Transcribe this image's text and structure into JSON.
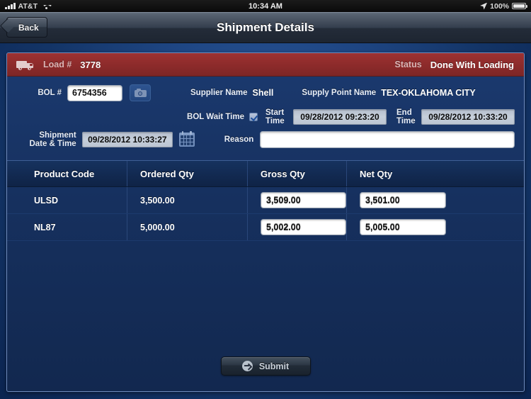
{
  "status_bar": {
    "carrier": "AT&T",
    "signal_icon": "signal-bars-icon",
    "wifi_icon": "wifi-icon",
    "time": "10:34 AM",
    "location_icon": "location-arrow-icon",
    "battery_percent": "100%",
    "battery_icon": "battery-icon"
  },
  "nav_bar": {
    "back_label": "Back",
    "title": "Shipment Details"
  },
  "load_bar": {
    "truck_icon": "truck-icon",
    "load_label": "Load #",
    "load_number": "3778",
    "status_label": "Status",
    "status_value": "Done With Loading",
    "background_color": "#8e2b2b"
  },
  "form": {
    "bol_label": "BOL #",
    "bol_value": "6754356",
    "camera_icon": "camera-icon",
    "supplier_name_label": "Supplier Name",
    "supplier_name_value": "Shell",
    "supply_point_label": "Supply Point Name",
    "supply_point_value": "TEX-OKLAHOMA CITY",
    "bol_wait_time_label": "BOL Wait Time",
    "bol_wait_time_checked": true,
    "start_time_label_1": "Start",
    "start_time_label_2": "Time",
    "start_time_value": "09/28/2012 09:23:20",
    "end_time_label_1": "End",
    "end_time_label_2": "Time",
    "end_time_value": "09/28/2012 10:33:20",
    "shipment_label_1": "Shipment",
    "shipment_label_2": "Date & Time",
    "shipment_datetime_value": "09/28/2012 10:33:27",
    "calendar_icon": "calendar-icon",
    "reason_label": "Reason",
    "reason_value": "",
    "reason_placeholder": ""
  },
  "table": {
    "columns": [
      "Product Code",
      "Ordered Qty",
      "Gross Qty",
      "Net Qty"
    ],
    "rows": [
      {
        "product_code": "ULSD",
        "ordered_qty": "3,500.00",
        "gross_qty": "3,509.00",
        "net_qty": "3,501.00"
      },
      {
        "product_code": "NL87",
        "ordered_qty": "5,000.00",
        "gross_qty": "5,002.00",
        "net_qty": "5,005.00"
      }
    ]
  },
  "submit": {
    "label": "Submit",
    "icon": "arrow-right-circle-icon"
  }
}
